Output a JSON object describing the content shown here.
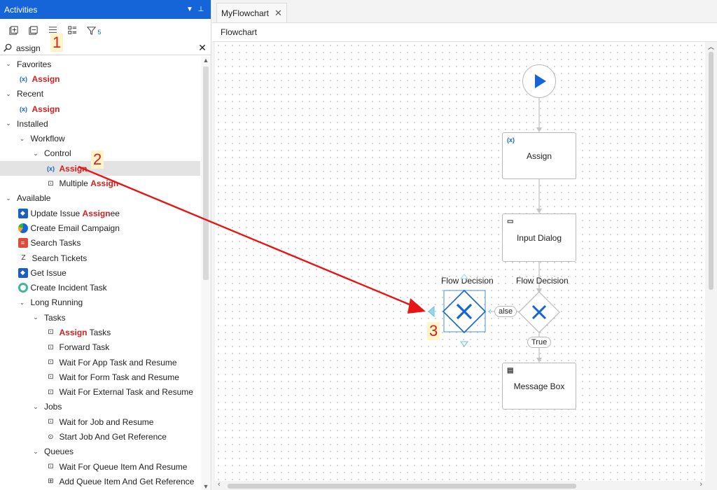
{
  "panel": {
    "title": "Activities",
    "filter_count": "5",
    "search_value": "assign",
    "tree": [
      {
        "depth": 0,
        "chev": "⌄",
        "text": "Favorites"
      },
      {
        "depth": 1,
        "icon": "var",
        "text": "Assign",
        "hl": true
      },
      {
        "depth": 0,
        "chev": "⌄",
        "text": "Recent"
      },
      {
        "depth": 1,
        "icon": "var",
        "text": "Assign",
        "hl": true
      },
      {
        "depth": 0,
        "chev": "⌄",
        "text": "Installed"
      },
      {
        "depth": 1,
        "chev": "⌄",
        "text": "Workflow"
      },
      {
        "depth": 2,
        "chev": "⌄",
        "text": "Control"
      },
      {
        "depth": 3,
        "icon": "var",
        "text": "Assign",
        "hl": true,
        "selected": true
      },
      {
        "depth": 3,
        "icon": "outline",
        "text": "Multiple ",
        "hltext": "Assign"
      },
      {
        "depth": 0,
        "chev": "⌄",
        "text": "Available"
      },
      {
        "depth": 1,
        "icon": "sq-blue",
        "text": "Update Issue ",
        "hltext": "Assign",
        "tail": "ee"
      },
      {
        "depth": 1,
        "icon": "circle-grad",
        "text": "Create Email Campaign"
      },
      {
        "depth": 1,
        "icon": "sq-red",
        "text": "Search Tasks"
      },
      {
        "depth": 1,
        "icon": "z",
        "text": "Search Tickets"
      },
      {
        "depth": 1,
        "icon": "sq-blue",
        "text": "Get Issue"
      },
      {
        "depth": 1,
        "icon": "circle-green",
        "text": "Create Incident Task"
      },
      {
        "depth": 1,
        "chev": "⌄",
        "text": "Long Running"
      },
      {
        "depth": 2,
        "chev": "⌄",
        "text": "Tasks"
      },
      {
        "depth": 3,
        "icon": "outline",
        "pre": "Assign",
        "text": " Tasks"
      },
      {
        "depth": 3,
        "icon": "outline",
        "text": "Forward Task"
      },
      {
        "depth": 3,
        "icon": "outline",
        "text": "Wait For App Task and Resume"
      },
      {
        "depth": 3,
        "icon": "outline",
        "text": "Wait for Form Task and Resume"
      },
      {
        "depth": 3,
        "icon": "outline",
        "text": "Wait For External Task and Resume"
      },
      {
        "depth": 2,
        "chev": "⌄",
        "text": "Jobs"
      },
      {
        "depth": 3,
        "icon": "outline",
        "text": "Wait for Job and Resume"
      },
      {
        "depth": 3,
        "icon": "play",
        "text": "Start Job And Get Reference"
      },
      {
        "depth": 2,
        "chev": "⌄",
        "text": "Queues"
      },
      {
        "depth": 3,
        "icon": "outline",
        "text": "Wait For Queue Item And Resume"
      },
      {
        "depth": 3,
        "icon": "plus",
        "text": "Add Queue Item And Get Reference"
      }
    ]
  },
  "designer": {
    "tab": "MyFlowchart",
    "breadcrumb": "Flowchart",
    "nodes": {
      "assign": "Assign",
      "input_dialog": "Input Dialog",
      "flow_decision_1": "Flow Decision",
      "flow_decision_2": "Flow Decision",
      "false_label": "alse",
      "true_label": "True",
      "message_box": "Message Box"
    }
  },
  "callouts": {
    "one": "1",
    "two": "2",
    "three": "3"
  },
  "colors": {
    "accent": "#1565d8",
    "highlight": "#d32020",
    "arrow": "#e81515"
  }
}
